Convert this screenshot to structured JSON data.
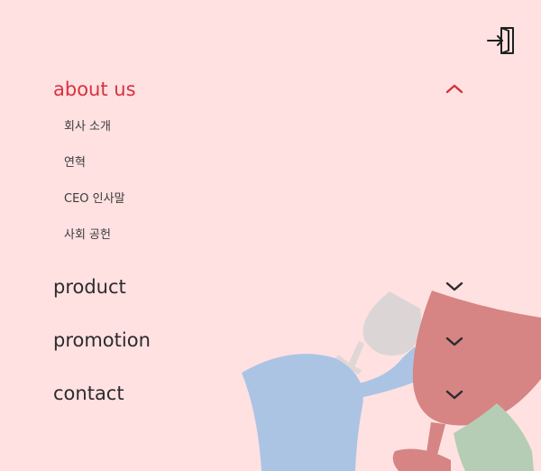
{
  "header": {
    "login_icon": "door-enter-icon"
  },
  "menu": {
    "items": [
      {
        "label": "about us",
        "expanded": true,
        "icon": "chevron-up-icon",
        "subitems": [
          "회사 소개",
          "연혁",
          "CEO 인사말",
          "사회 공헌"
        ]
      },
      {
        "label": "product",
        "expanded": false,
        "icon": "chevron-down-icon"
      },
      {
        "label": "promotion",
        "expanded": false,
        "icon": "chevron-down-icon"
      },
      {
        "label": "contact",
        "expanded": false,
        "icon": "chevron-down-icon"
      }
    ]
  },
  "colors": {
    "background": "#ffe1e1",
    "accent": "#d8313f",
    "text": "#2d2b2e",
    "glass_blue": "#abc4e4",
    "glass_red": "#d68484",
    "glass_grey": "#dcd5d6",
    "glass_green": "#b5cdb4"
  }
}
